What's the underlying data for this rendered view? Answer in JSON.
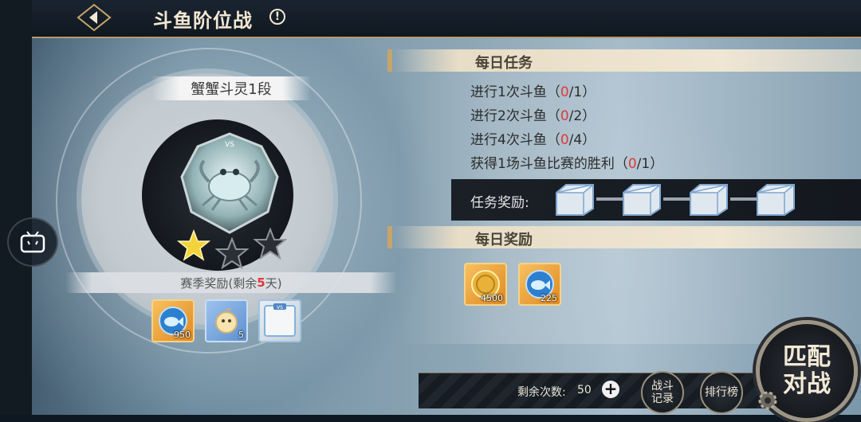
{
  "header": {
    "title": "斗鱼阶位战",
    "info_icon": "!"
  },
  "rank_panel": {
    "rank_name": "蟹蟹斗灵1段",
    "emblem_badge": "VS",
    "stars_filled": 1,
    "stars_total": 3,
    "season_reward": {
      "prefix": "赛季奖励(剩余",
      "days": "5",
      "suffix": "天)"
    },
    "rewards": [
      {
        "icon": "fish-token-icon",
        "qty": "950"
      },
      {
        "icon": "pet-egg-icon",
        "qty": "5"
      },
      {
        "icon": "vs-frame-icon",
        "qty": ""
      }
    ]
  },
  "daily_tasks": {
    "heading": "每日任务",
    "tasks": [
      {
        "text": "进行1次斗鱼（",
        "progress": "0",
        "total": "/1）"
      },
      {
        "text": "进行2次斗鱼（",
        "progress": "0",
        "total": "/2）"
      },
      {
        "text": "进行4次斗鱼（",
        "progress": "0",
        "total": "/4）"
      },
      {
        "text": "获得1场斗鱼比赛的胜利（",
        "progress": "0",
        "total": "/1）"
      }
    ],
    "reward_label": "任务奖励:",
    "reward_chests": [
      "silver-chest-icon",
      "silver-chest-icon",
      "silver-chest-icon",
      "silver-chest-icon"
    ]
  },
  "daily_rewards": {
    "heading": "每日奖励",
    "items": [
      {
        "icon": "gold-coin-icon",
        "qty": "4500"
      },
      {
        "icon": "fish-token-icon",
        "qty": "225"
      }
    ]
  },
  "bottom_bar": {
    "remain_label": "剩余次数:",
    "remain_value": "50",
    "battle_record": "战斗\n记录",
    "leaderboard": "排行榜",
    "match_button": "匹配\n对战"
  },
  "colors": {
    "accent_gold": "#c7a56a",
    "progress_red": "#e0393b",
    "dark_panel": "#14181e"
  }
}
